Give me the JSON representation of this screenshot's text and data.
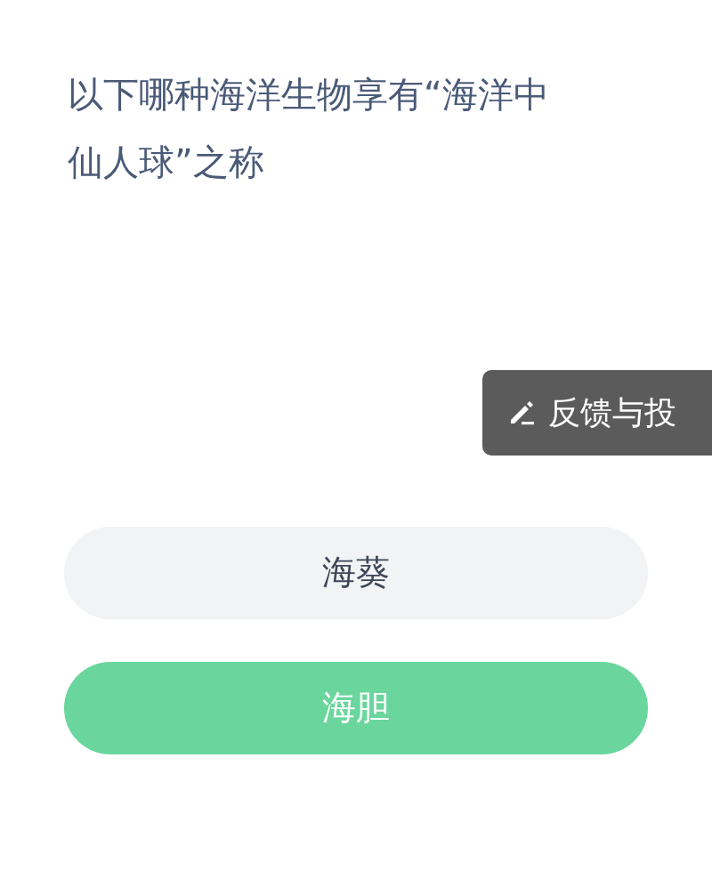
{
  "question": "以下哪种海洋生物享有“海洋中仙人球”之称",
  "feedback_button": {
    "label": "反馈与投"
  },
  "options": [
    {
      "label": "海葵",
      "selected": false
    },
    {
      "label": "海胆",
      "selected": true
    }
  ]
}
